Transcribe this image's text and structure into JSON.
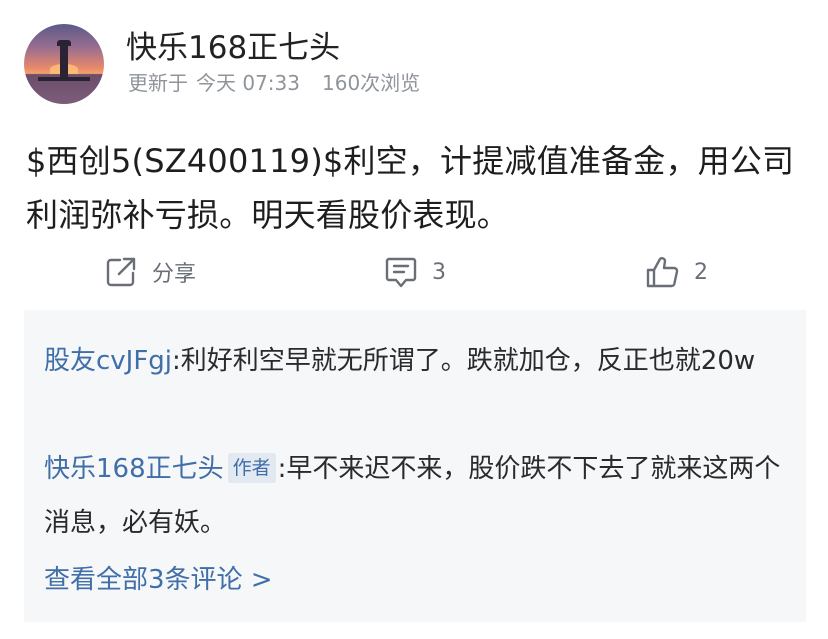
{
  "post": {
    "author": "快乐168正七头",
    "updated_label": "更新于",
    "updated_time": "今天 07:33",
    "views": "160次浏览",
    "content": "$西创5(SZ400119)$利空，计提减值准备金，用公司利润弥补亏损。明天看股价表现。"
  },
  "actions": {
    "share_label": "分享",
    "comment_count": "3",
    "like_count": "2"
  },
  "comments": {
    "items": [
      {
        "user": "股友cvJFgj",
        "badge": "",
        "text": ":利好利空早就无所谓了。跌就加仓，反正也就20w"
      },
      {
        "user": "快乐168正七头",
        "badge": "作者",
        "text": ":早不来迟不来，股价跌不下去了就来这两个消息，必有妖。"
      }
    ],
    "view_all": "查看全部3条评论 >"
  },
  "icons": {
    "share": "share-icon",
    "comment": "comment-icon",
    "like": "thumbs-up-icon"
  },
  "colors": {
    "link": "#3f6ea8",
    "meta": "#8f949a",
    "comment_bg": "#f5f7f9"
  }
}
